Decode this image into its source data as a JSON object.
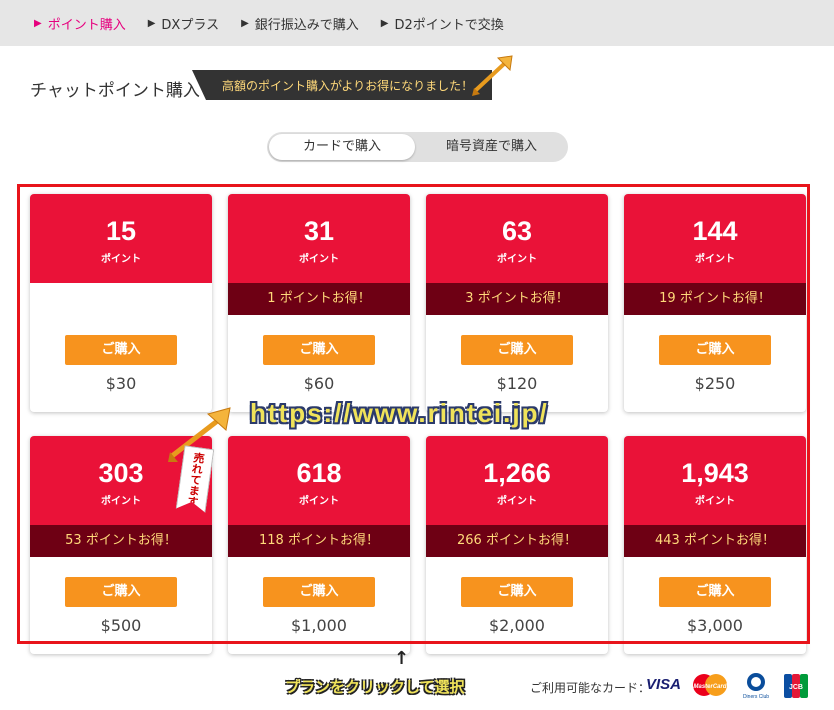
{
  "nav": {
    "items": [
      {
        "label": "ポイント購入",
        "active": true
      },
      {
        "label": "DXプラス",
        "active": false
      },
      {
        "label": "銀行振込みで購入",
        "active": false
      },
      {
        "label": "D2ポイントで交換",
        "active": false
      }
    ]
  },
  "section": {
    "title": "チャットポイント購入",
    "banner": "高額のポイント購入がよりお得になりました！"
  },
  "toggle": {
    "card_label": "カードで購入",
    "crypto_label": "暗号資産で購入"
  },
  "plans": [
    {
      "points": "15",
      "unit": "ポイント",
      "bonus": "",
      "buy": "ご購入",
      "price": "$30"
    },
    {
      "points": "31",
      "unit": "ポイント",
      "bonus": "1 ポイントお得！",
      "buy": "ご購入",
      "price": "$60"
    },
    {
      "points": "63",
      "unit": "ポイント",
      "bonus": "3 ポイントお得！",
      "buy": "ご購入",
      "price": "$120"
    },
    {
      "points": "144",
      "unit": "ポイント",
      "bonus": "19 ポイントお得！",
      "buy": "ご購入",
      "price": "$250"
    },
    {
      "points": "303",
      "unit": "ポイント",
      "bonus": "53 ポイントお得！",
      "buy": "ご購入",
      "price": "$500"
    },
    {
      "points": "618",
      "unit": "ポイント",
      "bonus": "118 ポイントお得！",
      "buy": "ご購入",
      "price": "$1,000"
    },
    {
      "points": "1,266",
      "unit": "ポイント",
      "bonus": "266 ポイントお得！",
      "buy": "ご購入",
      "price": "$2,000"
    },
    {
      "points": "1,943",
      "unit": "ポイント",
      "bonus": "443 ポイントお得！",
      "buy": "ご購入",
      "price": "$3,000"
    }
  ],
  "sold_badge": "売れてます",
  "watermark": "https://www.rintei.jp/",
  "instruction": "プランをクリックして選択",
  "up_arrow": "↑",
  "footer": {
    "cards_label": "ご利用可能なカード：",
    "visa": "VISA",
    "mastercard": "MasterCard",
    "diners": "Diners Club",
    "jcb": "JCB"
  },
  "colors": {
    "accent": "#e6007e",
    "card_red": "#ea1238",
    "bonus_dark": "#6e0014",
    "buy_orange": "#f7931e",
    "frame_red": "#e8141b"
  },
  "icons": [
    "nav-triangle-icon",
    "golden-arrow-icon",
    "sold-ribbon-icon",
    "visa-logo",
    "mastercard-logo",
    "diners-club-logo",
    "jcb-logo"
  ]
}
